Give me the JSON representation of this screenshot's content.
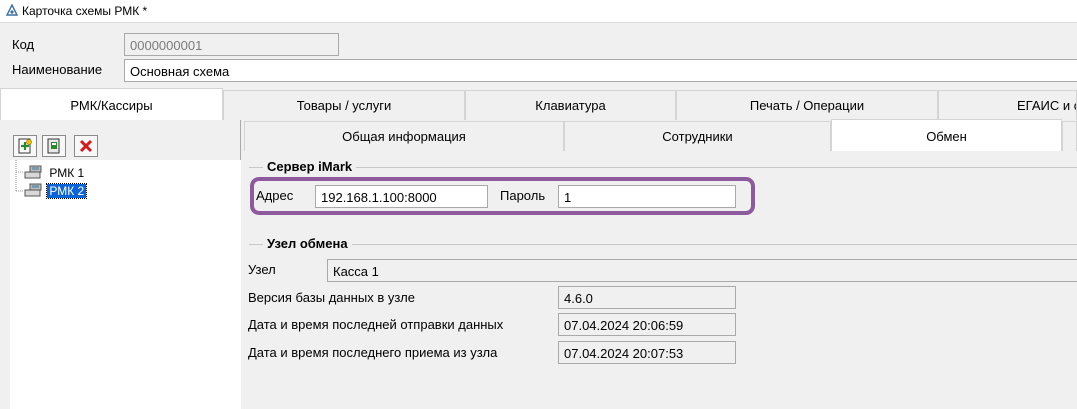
{
  "window": {
    "title": "Карточка схемы РМК *"
  },
  "form": {
    "code_label": "Код",
    "code_value": "0000000001",
    "name_label": "Наименование",
    "name_value": "Основная схема"
  },
  "main_tabs": [
    {
      "label": "РМК/Кассиры",
      "active": true
    },
    {
      "label": "Товары / услуги",
      "active": false
    },
    {
      "label": "Клавиатура",
      "active": false
    },
    {
      "label": "Печать / Операции",
      "active": false
    },
    {
      "label": "ЕГАИС и скри",
      "active": false
    }
  ],
  "tree": {
    "items": [
      {
        "label": "РМК 1",
        "selected": false
      },
      {
        "label": "РМК 2",
        "selected": true
      }
    ]
  },
  "sub_tabs": [
    {
      "label": "Общая информация",
      "active": false
    },
    {
      "label": "Сотрудники",
      "active": false
    },
    {
      "label": "Обмен",
      "active": true
    }
  ],
  "imark": {
    "title": "Сервер iMark",
    "address_label": "Адрес",
    "address_value": "192.168.1.100:8000",
    "password_label": "Пароль",
    "password_value": "1"
  },
  "exchange": {
    "title": "Узел обмена",
    "node_label": "Узел",
    "node_value": "Касса 1",
    "db_version_label": "Версия базы данных в узле",
    "db_version_value": "4.6.0",
    "last_send_label": "Дата и время последней отправки данных",
    "last_send_value": "07.04.2024 20:06:59",
    "last_receive_label": "Дата и время последнего приема из узла",
    "last_receive_value": "07.04.2024 20:07:53"
  },
  "colors": {
    "highlight": "#8e5a9e",
    "selection": "#0a64d8",
    "delete_icon": "#d21c1c"
  }
}
